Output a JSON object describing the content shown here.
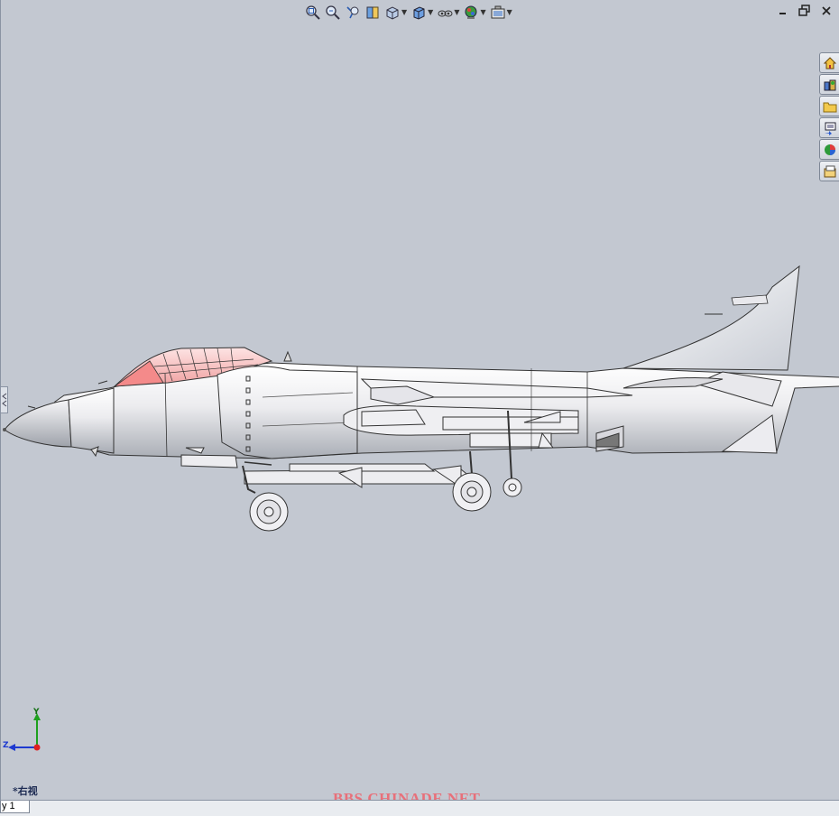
{
  "viewport": {
    "background": "#c3c8d1",
    "view_orientation_label": "*右视",
    "watermark": "BBS.CHINADE.NET",
    "triad": {
      "y_label": "Y",
      "z_label": "Z"
    }
  },
  "heads_up_toolbar": {
    "buttons": [
      {
        "icon": "zoom-to-fit-icon",
        "dropdown": false
      },
      {
        "icon": "zoom-to-area-icon",
        "dropdown": false
      },
      {
        "icon": "previous-view-icon",
        "dropdown": false
      },
      {
        "icon": "section-view-icon",
        "dropdown": false
      },
      {
        "icon": "view-orientation-icon",
        "dropdown": true
      },
      {
        "icon": "display-style-icon",
        "dropdown": true
      },
      {
        "icon": "hide-show-items-icon",
        "dropdown": true
      },
      {
        "icon": "edit-appearance-icon",
        "dropdown": true
      },
      {
        "icon": "apply-scene-icon",
        "dropdown": true
      }
    ]
  },
  "window_controls": {
    "minimize": "minimize-icon",
    "restore": "restore-icon",
    "close": "close-icon"
  },
  "task_pane": {
    "tabs": [
      "solidworks-resources-icon",
      "design-library-icon",
      "file-explorer-icon",
      "view-palette-icon",
      "appearances-scenes-icon",
      "custom-properties-icon"
    ]
  },
  "status": {
    "sheet_tab": "y 1"
  },
  "colors": {
    "canopy": "#f2b0b0",
    "fuselage": "#e6e6e9",
    "accent_red": "#e8707a"
  }
}
